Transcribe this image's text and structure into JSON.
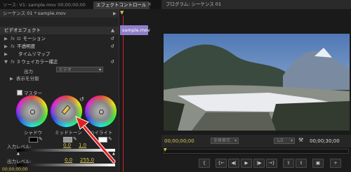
{
  "tabs": {
    "source": "ソース: V1: sample.mov  00;00;00;00",
    "effect_controls": "エフェクトコントロール",
    "program": "プログラム: シーケンス 01"
  },
  "effect_panel": {
    "sequence_label": "シーケンス 01 * sample.mov",
    "clip_name": "sample.mov",
    "section_title": "ビデオエフェクト",
    "effects": [
      {
        "label": "モーション"
      },
      {
        "label": "不透明度"
      },
      {
        "label": "タイムリマップ"
      },
      {
        "label": "3 ウェイカラー補正"
      }
    ],
    "output_label": "出力",
    "output_value": "ビデオ",
    "split_view_label": "表示を分割",
    "master_label": "マスター",
    "wheels": {
      "shadow": "シャドウ",
      "midtone": "ミッドトーン",
      "highlight": "ハイライト"
    },
    "input_levels_label": "入力レベル:",
    "input_values": [
      "0.0",
      "1.0"
    ],
    "output_levels_label": "出力レベル:",
    "output_values": [
      "0.0",
      "255.0"
    ],
    "timecode": "00;00;00;00"
  },
  "program_monitor": {
    "current_time": "00;00;00;00",
    "fit_label": "全体表示",
    "quality_label": "1/2",
    "duration": "00;00;30;00"
  },
  "colors": {
    "accent_clip": "#8f7fc9",
    "timecode": "#d9c24a",
    "arrow": "#e02020"
  }
}
